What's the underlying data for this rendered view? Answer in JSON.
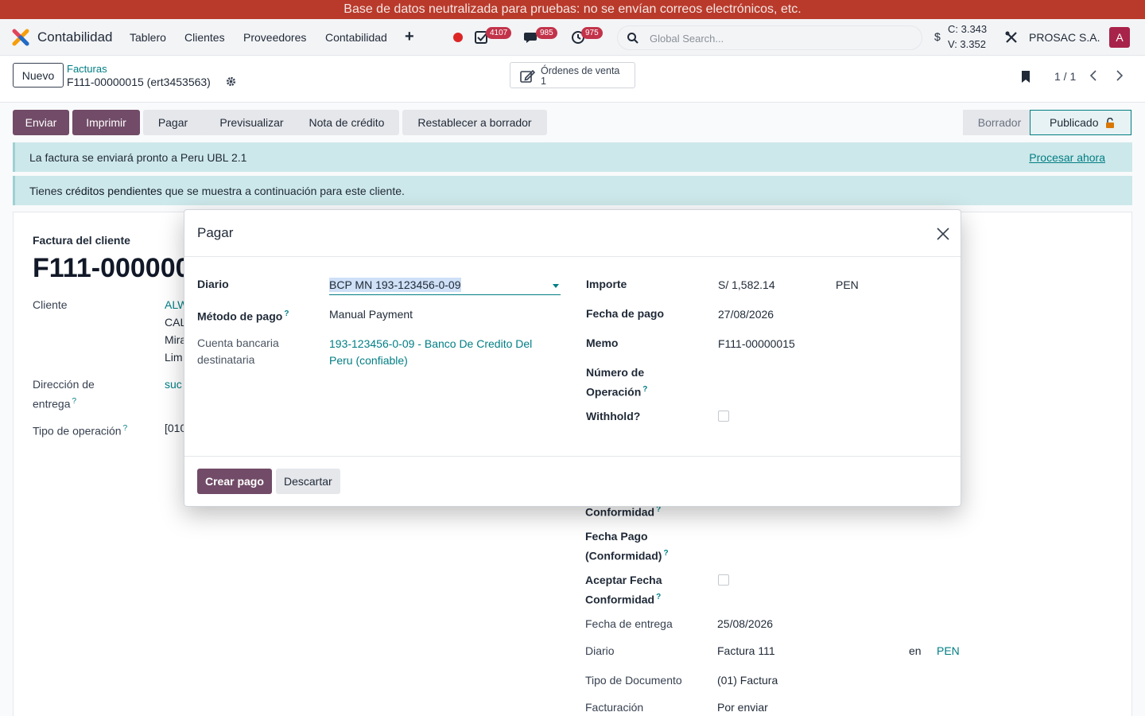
{
  "banner": {
    "text": "Base de datos neutralizada para pruebas: no se envían correos electrónicos, etc."
  },
  "navbar": {
    "app_name": "Contabilidad",
    "menu": [
      "Tablero",
      "Clientes",
      "Proveedores",
      "Contabilidad"
    ],
    "badges": {
      "activities": "4107",
      "messages": "985",
      "timers": "975"
    },
    "search_placeholder": "Global Search...",
    "currency_symbol": "$",
    "rate_buy": "C: 3.343",
    "rate_sell": "V: 3.352",
    "company": "PROSAC S.A.",
    "avatar_letter": "A"
  },
  "control": {
    "new_label": "Nuevo",
    "breadcrumb_parent": "Facturas",
    "record_title": "F111-00000015 (ert3453563)",
    "smart_button_label": "Órdenes de venta",
    "smart_button_value": "1",
    "pager": "1 / 1"
  },
  "actions": {
    "buttons": [
      "Enviar",
      "Imprimir",
      "Pagar",
      "Previsualizar",
      "Nota de crédito",
      "Restablecer a borrador"
    ],
    "stages": {
      "draft": "Borrador",
      "posted": "Publicado"
    }
  },
  "alerts": {
    "send": "La factura se enviará pronto a Peru UBL 2.1",
    "send_link": "Procesar ahora",
    "credits_pre": "Tienes ",
    "credits_bold": "créditos pendientes",
    "credits_post": " que se muestra a continuación para este cliente."
  },
  "sheet": {
    "subtitle": "Factura del cliente",
    "invoice_number": "F111-000000",
    "customer_label": "Cliente",
    "customer_lines": [
      "ALW",
      "CAL",
      "Mira",
      "Lim"
    ],
    "delivery_label_1": "Dirección de",
    "delivery_label_2": "entrega",
    "delivery_value": "suc",
    "op_type_label": "Tipo de operación",
    "op_type_value": "[010",
    "conformity_partial": "Conformidad",
    "payment_date_conf_1": "Fecha Pago",
    "payment_date_conf_2": "(Conformidad)",
    "accept_date_1": "Aceptar Fecha",
    "accept_date_2": "Conformidad",
    "delivery_date_label": "Fecha de entrega",
    "delivery_date_value": "25/08/2026",
    "journal_label": "Diario",
    "journal_value": "Factura 111",
    "journal_in": "en",
    "journal_currency": "PEN",
    "doc_type_label": "Tipo de Documento",
    "doc_type_value": "(01) Factura",
    "billing_label": "Facturación",
    "billing_value": "Por enviar"
  },
  "modal": {
    "title": "Pagar",
    "journal_label": "Diario",
    "journal_value": "BCP MN 193-123456-0-09",
    "method_label": "Método de pago",
    "method_value": "Manual Payment",
    "bank_label_1": "Cuenta bancaria",
    "bank_label_2": "destinataria",
    "bank_value_1": "193-123456-0-09 - Banco De Credito Del",
    "bank_value_2": "Peru (confiable)",
    "amount_label": "Importe",
    "amount_value": "S/ 1,582.14",
    "amount_currency": "PEN",
    "date_label": "Fecha de pago",
    "date_value": "27/08/2026",
    "memo_label": "Memo",
    "memo_value": "F111-00000015",
    "op_number_label_1": "Número de",
    "op_number_label_2": "Operación",
    "withhold_label": "Withhold?",
    "create_button": "Crear pago",
    "discard_button": "Descartar"
  },
  "help_mark": "?",
  "colors": {
    "primary": "#714b67",
    "link": "#017e84",
    "banner": "#b93a2b",
    "badge": "#c2334a"
  }
}
